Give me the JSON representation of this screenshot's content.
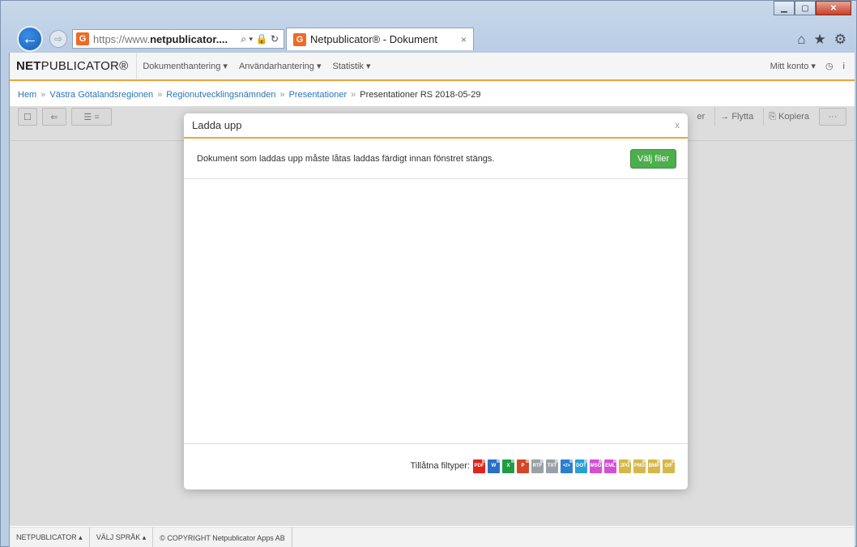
{
  "browser": {
    "url_prefix": "https://www.",
    "url_domain": "netpublicator....",
    "url_tools": "⌕ ▾ 🔒 ↻",
    "favicon_letter": "G",
    "tab_title": "Netpublicator® - Dokument",
    "tab_close": "×",
    "icons": [
      "home-icon",
      "star-icon",
      "gear-icon"
    ],
    "window_buttons": [
      "minimize",
      "maximize",
      "close"
    ]
  },
  "app": {
    "logo_bold": "NET",
    "logo_rest": "PUBLICATOR®",
    "nav": [
      {
        "label": "Dokumenthantering ▾"
      },
      {
        "label": "Användarhantering ▾"
      },
      {
        "label": "Statistik ▾"
      }
    ],
    "account_label": "Mitt konto ▾",
    "info_label": "i"
  },
  "breadcrumb": {
    "items": [
      "Hem",
      "Västra Götalandsregionen",
      "Regionutvecklingsnämnden",
      "Presentationer"
    ],
    "separator": "»",
    "current": "Presentationer RS 2018-05-29"
  },
  "toolbar": {
    "right_cut": "er",
    "move_label": "Flytta",
    "copy_label": "Kopiera",
    "more_label": "···"
  },
  "modal": {
    "title": "Ladda upp",
    "close": "x",
    "info_text": "Dokument som laddas upp måste låtas laddas färdigt innan fönstret stängs.",
    "choose_button": "Välj filer",
    "filetypes_label": "Tillåtna filtyper:",
    "filetypes": [
      {
        "label": "PDF",
        "color": "#e2231a"
      },
      {
        "label": "W",
        "color": "#2b6fc7"
      },
      {
        "label": "X",
        "color": "#1f9d45"
      },
      {
        "label": "P",
        "color": "#d24726"
      },
      {
        "label": "RTF",
        "color": "#9aa0a6"
      },
      {
        "label": "TXT",
        "color": "#9aa0a6"
      },
      {
        "label": "</>",
        "color": "#2b7fd0"
      },
      {
        "label": "DOT",
        "color": "#2b9fd8"
      },
      {
        "label": "MSG",
        "color": "#d64ed6"
      },
      {
        "label": "EML",
        "color": "#d64ed6"
      },
      {
        "label": "JPG",
        "color": "#d6b84a"
      },
      {
        "label": "PNG",
        "color": "#d6b84a"
      },
      {
        "label": "BMP",
        "color": "#d6b84a"
      },
      {
        "label": "GIF",
        "color": "#d6b84a"
      }
    ]
  },
  "footer": {
    "items": [
      "NETPUBLICATOR ▴",
      "VÄLJ SPRÅK ▴",
      "© COPYRIGHT Netpublicator Apps AB"
    ]
  }
}
